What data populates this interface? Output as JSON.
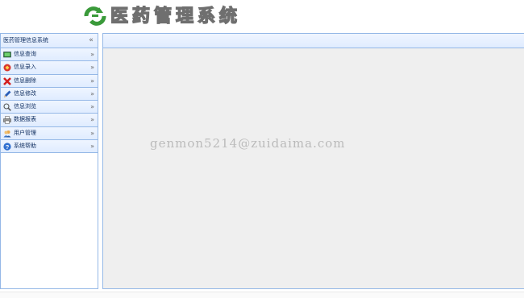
{
  "header": {
    "title": "医药管理系统"
  },
  "sidebar": {
    "title": "医药管理信息系统",
    "collapse_icon": "double-chevron-left-icon",
    "items": [
      {
        "label": "信息查询",
        "icon": "monitor-icon"
      },
      {
        "label": "信息录入",
        "icon": "entry-icon"
      },
      {
        "label": "信息删除",
        "icon": "delete-x-icon"
      },
      {
        "label": "信息修改",
        "icon": "pencil-icon"
      },
      {
        "label": "信息浏览",
        "icon": "magnifier-icon"
      },
      {
        "label": "数据报表",
        "icon": "printer-icon"
      },
      {
        "label": "用户管理",
        "icon": "users-icon"
      },
      {
        "label": "系统帮助",
        "icon": "help-icon"
      }
    ]
  },
  "main": {
    "watermark": "genmon5214@zuidaima.com"
  },
  "colors": {
    "panel_border": "#95b8e7",
    "panel_header": "#e0ecff",
    "label_text": "#0e2d5f",
    "content_bg": "#efefef",
    "logo_green": "#3a9a3a"
  }
}
